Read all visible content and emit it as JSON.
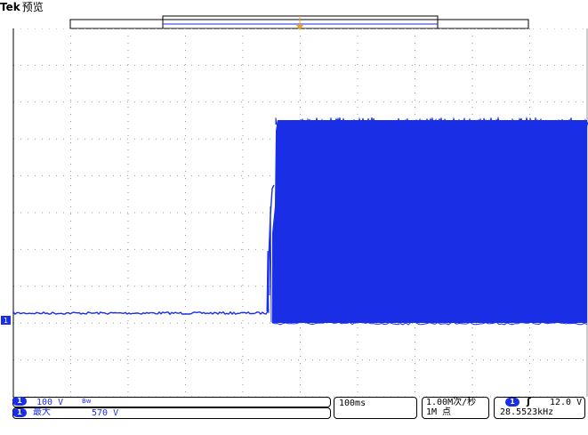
{
  "header": {
    "brand": "Tek",
    "mode": "预览"
  },
  "channel_marker": "1",
  "readouts": {
    "ch1_scale": "100 V",
    "ch1_coupling_symbol": "Bw",
    "measurement_label": "最大",
    "measurement_value": "570 V",
    "timebase": "100ms",
    "sample_rate": "1.00M次/秒",
    "record_length": "1M 点",
    "trigger_level": "12.0 V",
    "trigger_slope_symbol": "ʃ",
    "trigger_frequency": "28.5523kHz"
  },
  "colors": {
    "trace": "#1a2ee6",
    "grid": "#9a9a9a",
    "trigger_marker": "#f0a020"
  }
}
